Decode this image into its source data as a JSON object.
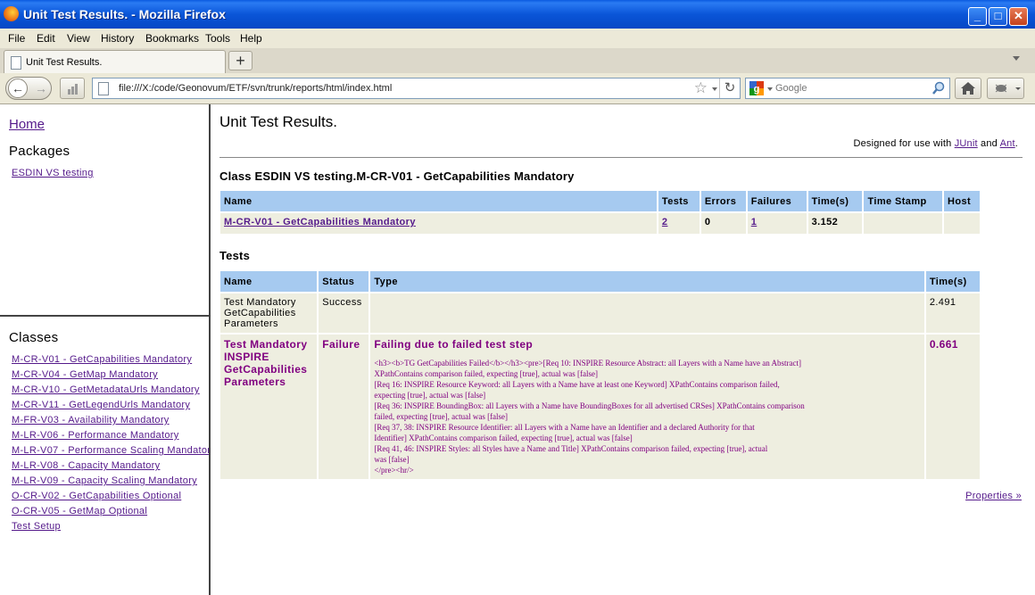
{
  "window": {
    "title": "Unit Test Results. - Mozilla Firefox"
  },
  "menu": [
    "File",
    "Edit",
    "View",
    "History",
    "Bookmarks",
    "Tools",
    "Help"
  ],
  "tab": {
    "label": "Unit Test Results."
  },
  "nav": {
    "url": "file:///X:/code/Geonovum/ETF/svn/trunk/reports/html/index.html",
    "search_placeholder": "Google"
  },
  "sidebar": {
    "home": "Home",
    "packages_heading": "Packages",
    "packages": [
      "ESDIN VS testing"
    ],
    "classes_heading": "Classes",
    "classes": [
      "M-CR-V01 - GetCapabilities Mandatory",
      "M-CR-V04 - GetMap Mandatory",
      "M-CR-V10 - GetMetadataUrls Mandatory",
      "M-CR-V11 - GetLegendUrls Mandatory",
      "M-FR-V03 - Availability Mandatory",
      "M-LR-V06 - Performance Mandatory",
      "M-LR-V07 - Performance Scaling Mandatory",
      "M-LR-V08 - Capacity Mandatory",
      "M-LR-V09 - Capacity Scaling Mandatory",
      "O-CR-V02 - GetCapabilities Optional",
      "O-CR-V05 - GetMap Optional",
      "Test Setup"
    ]
  },
  "main": {
    "title": "Unit Test Results.",
    "designed_prefix": "Designed for use with ",
    "junit": "JUnit",
    "and": " and ",
    "ant": "Ant",
    "period": ".",
    "class_heading": "Class ESDIN VS testing.M-CR-V01 - GetCapabilities Mandatory",
    "summary_headers": [
      "Name",
      "Tests",
      "Errors",
      "Failures",
      "Time(s)",
      "Time Stamp",
      "Host"
    ],
    "summary_row": {
      "name": "M-CR-V01 - GetCapabilities Mandatory",
      "tests": "2",
      "errors": "0",
      "failures": "1",
      "time": "3.152",
      "timestamp": "",
      "host": ""
    },
    "tests_heading": "Tests",
    "tests_headers": [
      "Name",
      "Status",
      "Type",
      "Time(s)"
    ],
    "tests": [
      {
        "name": "Test Mandatory GetCapabilities Parameters",
        "status": "Success",
        "type": "",
        "time": "2.491"
      },
      {
        "name": "Test Mandatory INSPIRE GetCapabilities Parameters",
        "status": "Failure",
        "message": "Failing due to failed test step",
        "detail": [
          "<h3><b>TG GetCapabilities Failed</b></h3><pre>[Req 10: INSPIRE Resource Abstract: all Layers with a Name have an Abstract]",
          "XPathContains comparison failed, expecting [true], actual was [false]",
          "[Req 16: INSPIRE Resource Keyword: all Layers with a Name have at least one Keyword] XPathContains comparison failed,",
          "expecting [true], actual was [false]",
          "[Req 36: INSPIRE BoundingBox: all Layers with a Name have BoundingBoxes for all advertised CRSes] XPathContains comparison",
          "failed, expecting [true], actual was [false]",
          "[Req 37, 38: INSPIRE Resource Identifier: all Layers with a Name have an Identifier and a declared Authority for that",
          "Identifier] XPathContains comparison failed, expecting [true], actual was [false]",
          "[Req 41, 46: INSPIRE Styles: all Styles have a Name and Title] XPathContains comparison failed, expecting [true], actual",
          "was [false]",
          "</pre><hr/>"
        ],
        "time": "0.661"
      }
    ],
    "properties_link": "Properties »"
  }
}
